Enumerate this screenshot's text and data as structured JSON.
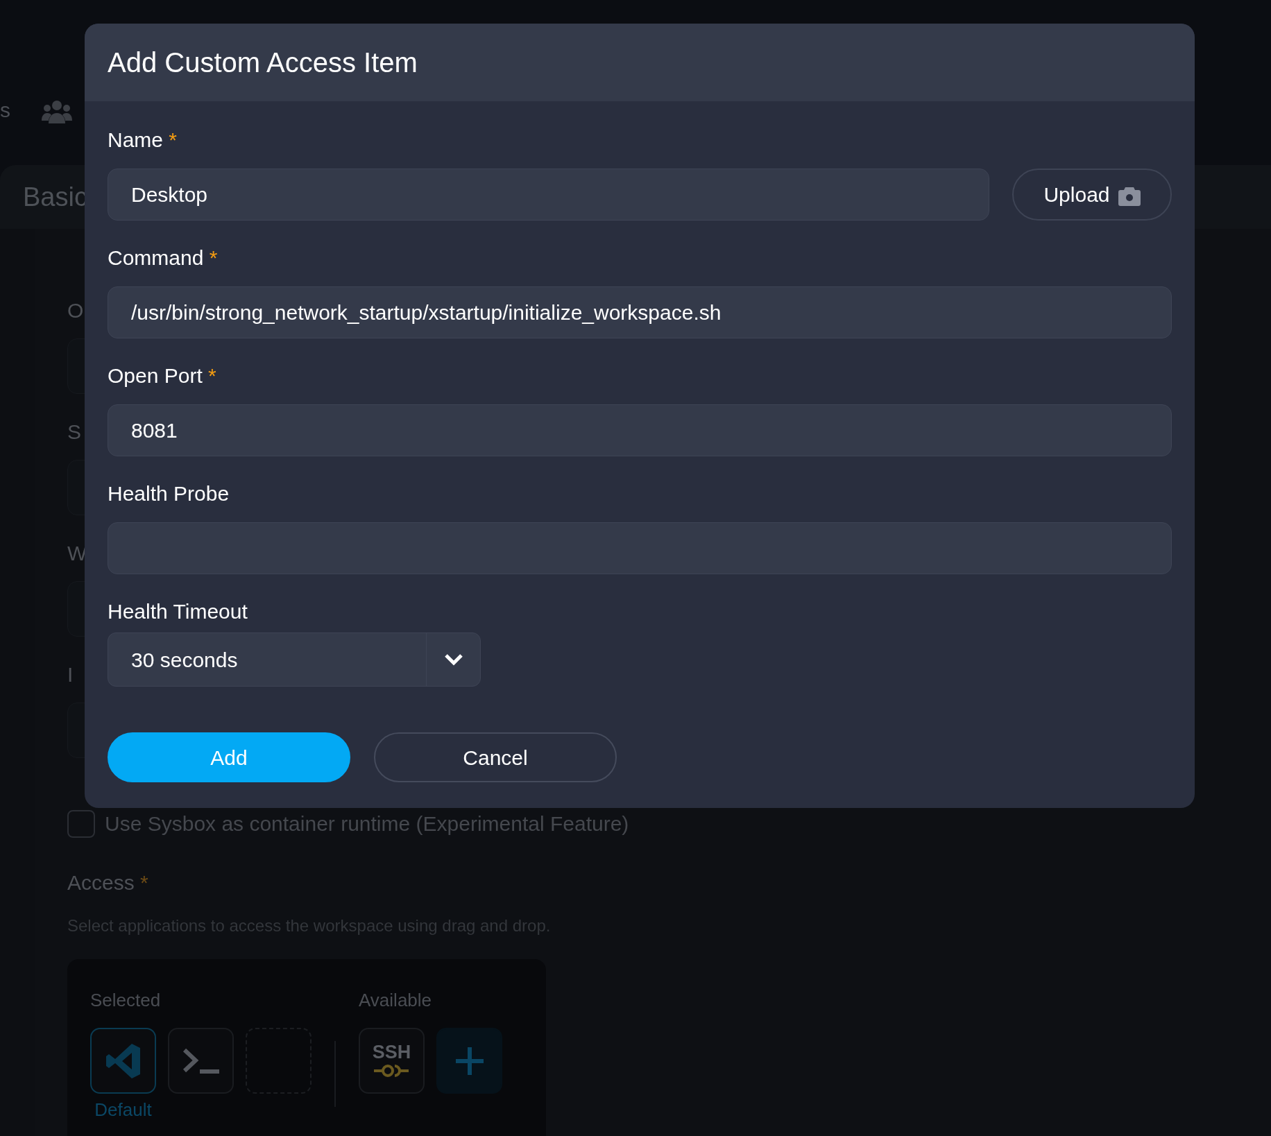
{
  "background": {
    "nav_tab_fragment": "s",
    "section_title": "Basic",
    "field_labels": [
      "O",
      "S",
      "W",
      "I"
    ],
    "sysbox": {
      "label": "Use Sysbox as container runtime (Experimental Feature)",
      "checked": false
    },
    "access": {
      "label": "Access",
      "required_mark": "*",
      "description": "Select applications to access the workspace using drag and drop.",
      "selected_heading": "Selected",
      "available_heading": "Available",
      "selected": [
        {
          "kind": "vscode",
          "caption": "Default"
        },
        {
          "kind": "terminal"
        },
        {
          "kind": "empty"
        }
      ],
      "available": [
        {
          "kind": "ssh",
          "text": "SSH"
        },
        {
          "kind": "add"
        }
      ]
    }
  },
  "dialog": {
    "title": "Add Custom Access Item",
    "fields": [
      {
        "kind": "text",
        "label": "Name",
        "required_mark": "*",
        "value": "Desktop",
        "upload": "Upload"
      },
      {
        "kind": "text",
        "label": "Command",
        "required_mark": "*",
        "value": "/usr/bin/strong_network_startup/xstartup/initialize_workspace.sh"
      },
      {
        "kind": "text",
        "label": "Open Port",
        "required_mark": "*",
        "value": "8081"
      },
      {
        "kind": "text",
        "label": "Health Probe"
      },
      {
        "kind": "select",
        "label": "Health Timeout",
        "value": "30 seconds"
      }
    ],
    "buttons": [
      {
        "kind": "primary",
        "label": "Add"
      },
      {
        "kind": "secondary",
        "label": "Cancel"
      }
    ]
  }
}
